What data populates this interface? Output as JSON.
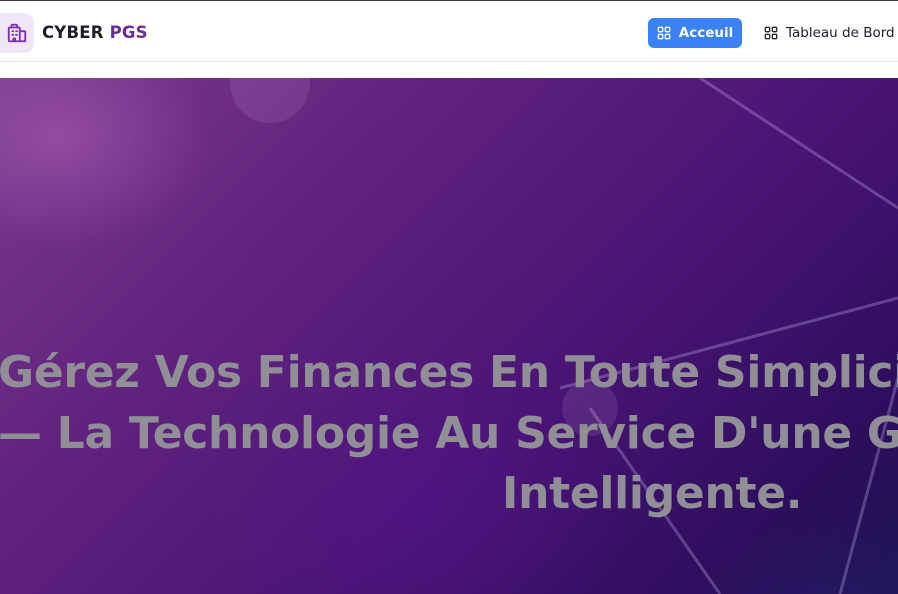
{
  "header": {
    "brand_part1": "CYBER",
    "brand_part2": "PGS",
    "logo_icon": "building-icon",
    "nav": [
      {
        "label": "Acceuil",
        "icon": "dashboard-grid-icon",
        "active": true
      },
      {
        "label": "Tableau de Bord",
        "icon": "dashboard-grid-icon",
        "active": false
      }
    ]
  },
  "hero": {
    "line1": "Gérez Vos Finances En Toute Simplicité",
    "line2": "— La Technologie Au Service D'une Ge",
    "line3": "Intelligente."
  },
  "colors": {
    "accent": "#3b82f6",
    "brand_purple": "#6a2b9a",
    "hero_text": "#8f8f95"
  }
}
